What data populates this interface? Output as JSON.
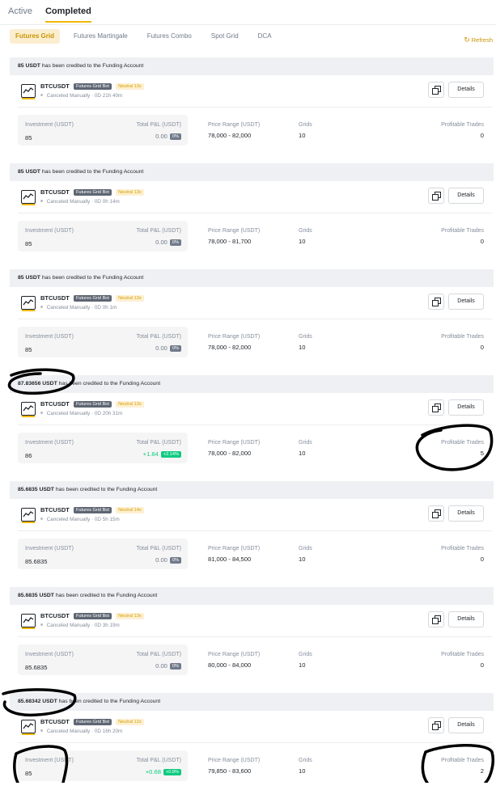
{
  "top_tabs": [
    {
      "label": "Active",
      "active": false
    },
    {
      "label": "Completed",
      "active": true
    }
  ],
  "sub_tabs": [
    {
      "label": "Futures Grid",
      "active": true
    },
    {
      "label": "Futures Martingale",
      "active": false
    },
    {
      "label": "Futures Combo",
      "active": false
    },
    {
      "label": "Spot Grid",
      "active": false
    },
    {
      "label": "DCA",
      "active": false
    }
  ],
  "refresh_label": "Refresh",
  "labels": {
    "credited_suffix": "has been credited to the Funding Account",
    "bot_type": "Futures Grid Bot",
    "investment": "Investment (USDT)",
    "total_pnl": "Total P&L (USDT)",
    "price_range": "Price Range (USDT)",
    "grids": "Grids",
    "profitable_trades": "Profitable Trades",
    "details": "Details"
  },
  "colors": {
    "accent": "#f0b90b",
    "positive": "#0ecb81",
    "neutral_tag": "#fdf0d2"
  },
  "cards": [
    {
      "credited": "85 USDT",
      "pair": "BTCUSDT",
      "mode": "Neutral 13x",
      "status": "Canceled Manually · 0D 21h 40m",
      "investment": "85",
      "pnl": "0.00",
      "pnl_pct": "0%",
      "pnl_positive": false,
      "price_range": "78,000 - 82,000",
      "grids": "10",
      "profitable_trades": "0"
    },
    {
      "credited": "85 USDT",
      "pair": "BTCUSDT",
      "mode": "Neutral 13x",
      "status": "Canceled Manually · 0D 0h 14m",
      "investment": "85",
      "pnl": "0.00",
      "pnl_pct": "0%",
      "pnl_positive": false,
      "price_range": "78,000 - 81,700",
      "grids": "10",
      "profitable_trades": "0"
    },
    {
      "credited": "85 USDT",
      "pair": "BTCUSDT",
      "mode": "Neutral 13x",
      "status": "Canceled Manually · 0D 0h 1m",
      "investment": "85",
      "pnl": "0.00",
      "pnl_pct": "0%",
      "pnl_positive": false,
      "price_range": "78,000 - 82,000",
      "grids": "10",
      "profitable_trades": "0"
    },
    {
      "credited": "87.83656 USDT",
      "pair": "BTCUSDT",
      "mode": "Neutral 13x",
      "status": "Canceled Manually · 0D 20h 31m",
      "investment": "86",
      "pnl": "+1.84",
      "pnl_pct": "+2.14%",
      "pnl_positive": true,
      "price_range": "78,000 - 82,000",
      "grids": "10",
      "profitable_trades": "5"
    },
    {
      "credited": "85.6835 USDT",
      "pair": "BTCUSDT",
      "mode": "Neutral 14x",
      "status": "Canceled Manually · 0D 5h 15m",
      "investment": "85.6835",
      "pnl": "0.00",
      "pnl_pct": "0%",
      "pnl_positive": false,
      "price_range": "81,000 - 84,500",
      "grids": "10",
      "profitable_trades": "0"
    },
    {
      "credited": "85.6835 USDT",
      "pair": "BTCUSDT",
      "mode": "Neutral 13x",
      "status": "Canceled Manually · 0D 3h 19m",
      "investment": "85.6835",
      "pnl": "0.00",
      "pnl_pct": "0%",
      "pnl_positive": false,
      "price_range": "80,000 - 84,000",
      "grids": "10",
      "profitable_trades": "0"
    },
    {
      "credited": "85.68342 USDT",
      "pair": "BTCUSDT",
      "mode": "Neutral 12x",
      "status": "Canceled Manually · 0D 16h 20m",
      "investment": "85",
      "pnl": "+0.68",
      "pnl_pct": "+0.8%",
      "pnl_positive": true,
      "price_range": "79,850 - 83,600",
      "grids": "10",
      "profitable_trades": "2"
    }
  ]
}
